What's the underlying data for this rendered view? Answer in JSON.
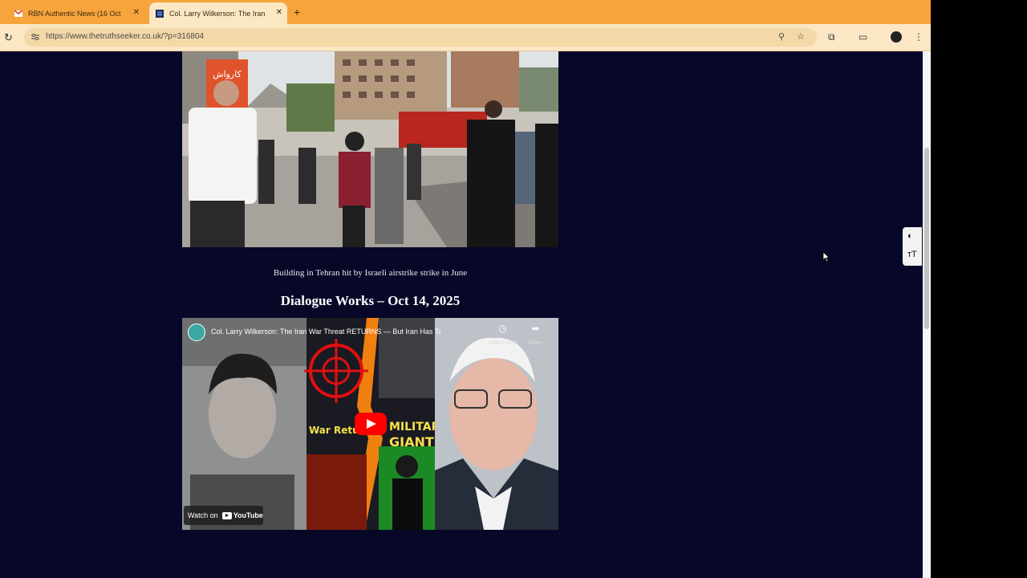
{
  "browser": {
    "tabs": [
      {
        "title": "RBN Authentic News (16 Oct",
        "active": false
      },
      {
        "title": "Col. Larry Wilkerson: The Iran",
        "active": true
      }
    ],
    "new_tab_label": "+",
    "url": "https://www.thetruthseeker.co.uk/?p=316804",
    "icons": [
      "reload-icon",
      "site-info-icon",
      "zoom-icon",
      "bookmark-star-icon",
      "extensions-icon",
      "tab-search-icon",
      "profile-avatar",
      "menu-icon"
    ]
  },
  "article": {
    "photo_alt_text": "كارواش",
    "caption": "Building in Tehran hit by Israeli airstrike strike in June",
    "heading": "Dialogue Works – Oct 14, 2025",
    "video": {
      "title": "Col. Larry Wilkerson: The Iran War Threat RETURNS — But Iran Has Tr",
      "watch_later": "Watch later",
      "share": "Share",
      "watch_on": "Watch on",
      "youtube": "YouTube",
      "thumb_text_left": "War Retu",
      "thumb_text_right_1": "MILITARY",
      "thumb_text_right_2": "GIANT!"
    }
  },
  "accessibility_widget": {
    "contrast_icon": "contrast-icon",
    "text_size_icon": "text-size-icon"
  },
  "colors": {
    "page_background": "#070728",
    "tab_bar": "#f6a43c",
    "toolbar": "#fbe7c4"
  }
}
